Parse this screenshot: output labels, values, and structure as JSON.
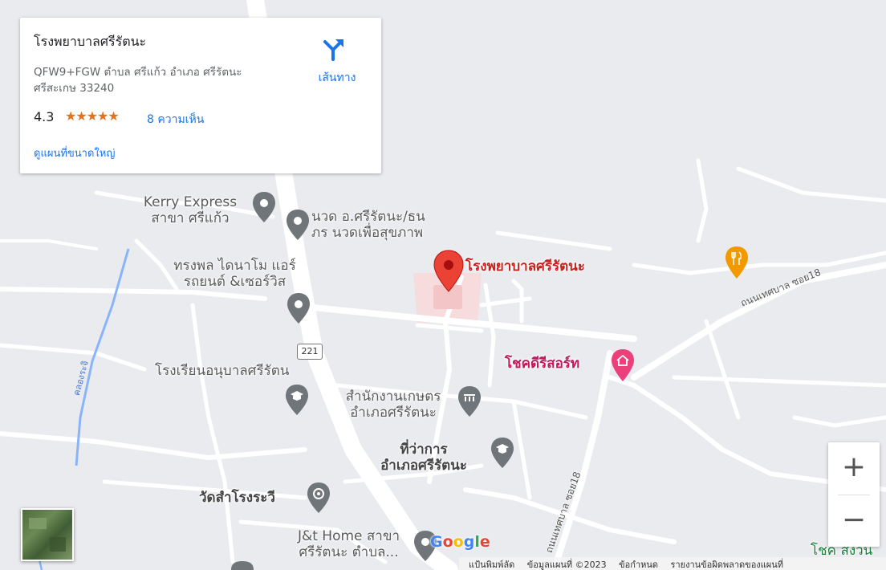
{
  "info_card": {
    "title": "โรงพยาบาลศรีรัตนะ",
    "address": "QFW9+FGW ตำบล ศรีแก้ว อำเภอ ศรีรัตนะ ศรีสะเกษ 33240",
    "rating": "4.3",
    "stars": "★★★★★",
    "rating_fraction": 0.86,
    "reviews": "8 ความเห็น",
    "larger_map": "ดูแผนที่ขนาดใหญ่",
    "directions": "เส้นทาง"
  },
  "places": [
    {
      "id": "kerry",
      "line1": "Kerry Express",
      "line2": "สาขา ศรีแก้ว"
    },
    {
      "id": "massage",
      "line1": "นวด อ.ศรีรัตนะ/ธน",
      "line2": "ภร นวดเพื่อสุขภาพ"
    },
    {
      "id": "hospital",
      "line1": "โรงพยาบาลศรีรัตนะ"
    },
    {
      "id": "dynamo",
      "line1": "ทรงพล ไดนาโม แอร์",
      "line2": "รถยนต์ &เซอร์วิส"
    },
    {
      "id": "kindergarten",
      "line1": "โรงเรียนอนุบาลศรีรัตน"
    },
    {
      "id": "resort",
      "line1": "โชคดีรีสอร์ท"
    },
    {
      "id": "agri_office",
      "line1": "สำนักงานเกษตร",
      "line2": "อำเภอศรีรัตนะ"
    },
    {
      "id": "district_office",
      "line1": "ที่ว่าการ",
      "line2": "อำเภอศรีรัตนะ"
    },
    {
      "id": "temple",
      "line1": "วัดสำโรงระวี"
    },
    {
      "id": "jt_home",
      "line1": "J&t Home สาขา",
      "line2": "ศรีรัตนะ ตำบล..."
    },
    {
      "id": "chok_suan",
      "line1": "โชค สงวน"
    }
  ],
  "roads": {
    "route_number": "221",
    "thetsaban_18_upper": "ถนนเทศบาล ซอย18",
    "thetsaban_18_lower": "ถนนเทศบาล ซอย18",
    "canal": "คลองระจิ"
  },
  "controls": {
    "zoom_in": "+",
    "zoom_out": "−"
  },
  "logo": {
    "letters": [
      "G",
      "o",
      "o",
      "g",
      "l",
      "e"
    ],
    "colors": [
      "#4285f4",
      "#ea4335",
      "#fbbc05",
      "#4285f4",
      "#34a853",
      "#ea4335"
    ]
  },
  "attribution": {
    "shortcuts": "แป้นพิมพ์ลัด",
    "map_data": "ข้อมูลแผนที่ ©2023",
    "terms": "ข้อกำหนด",
    "report": "รายงานข้อผิดพลาดของแผนที่"
  },
  "colors": {
    "map_bg": "#eaebef",
    "road": "#ffffff",
    "water": "#8ab4f8",
    "pin_red": "#ea4335",
    "pin_gray": "#70757a",
    "pin_food": "#f29900",
    "pin_pink": "#ec407a",
    "link_blue": "#1a73e8",
    "star_orange": "#e7711b"
  }
}
